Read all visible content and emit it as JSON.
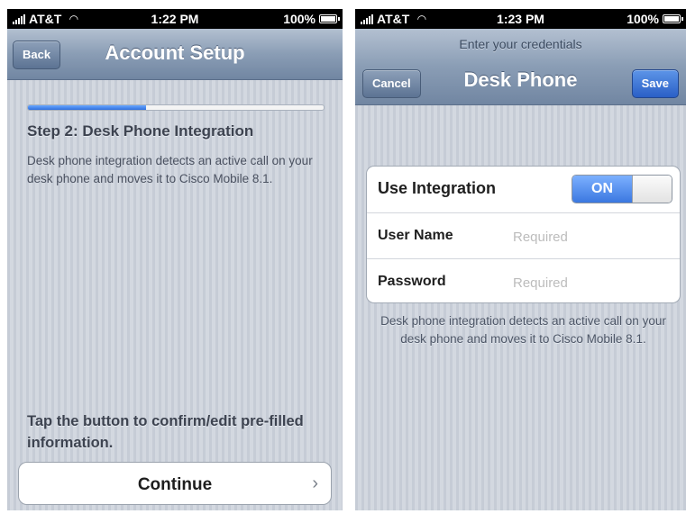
{
  "left_screen": {
    "status_bar": {
      "carrier": "AT&T",
      "time": "1:22 PM",
      "battery": "100%"
    },
    "nav": {
      "back_label": "Back",
      "title": "Account Setup"
    },
    "progress": {
      "fraction": 0.4
    },
    "step_title": "Step 2: Desk Phone Integration",
    "step_description": "Desk phone integration detects an active call on your desk phone and moves it to Cisco Mobile 8.1.",
    "confirm_text": "Tap the button to confirm/edit pre-filled information.",
    "continue_label": "Continue",
    "chevron": "›"
  },
  "right_screen": {
    "status_bar": {
      "carrier": "AT&T",
      "time": "1:23 PM",
      "battery": "100%"
    },
    "nav": {
      "prompt": "Enter your credentials",
      "cancel_label": "Cancel",
      "title": "Desk Phone",
      "save_label": "Save"
    },
    "form": {
      "use_integration_label": "Use Integration",
      "toggle_label": "ON",
      "toggle_on": true,
      "user_name_label": "User Name",
      "user_name_placeholder": "Required",
      "password_label": "Password",
      "password_placeholder": "Required"
    },
    "footnote": "Desk phone integration detects an active call on your desk phone and moves it to Cisco Mobile 8.1."
  },
  "colors": {
    "nav_gradient_top": "#b3c0d1",
    "nav_gradient_bottom": "#7186a2",
    "progress_fill": "#2f6fdc",
    "save_button": "#2a5fc6",
    "toggle_on": "#3b78e0"
  },
  "icons": [
    "signal-icon",
    "wifi-icon",
    "battery-icon",
    "chevron-right-icon"
  ]
}
